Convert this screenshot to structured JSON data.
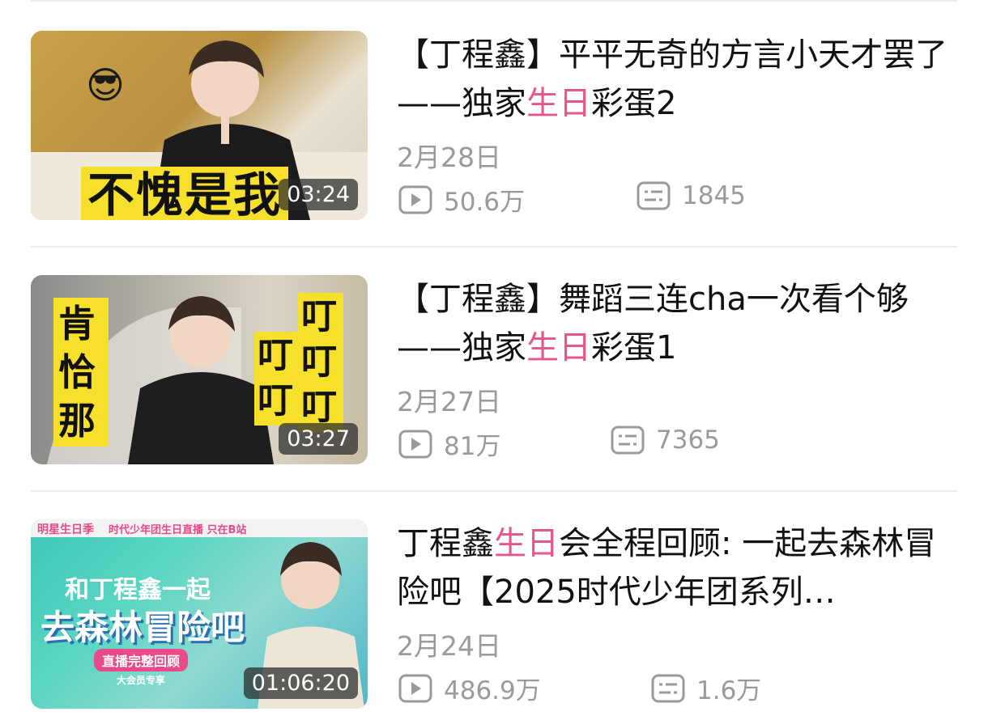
{
  "videos": [
    {
      "title_prefix": "【丁程鑫】平平无奇的方言小天才罢了——独家",
      "title_highlight": "生日",
      "title_suffix": "彩蛋2",
      "date": "2月28日",
      "views": "50.6万",
      "comments": "1845",
      "duration": "03:24",
      "cover_caption": "不愧是我",
      "cover_emoji": "😎"
    },
    {
      "title_prefix": "【丁程鑫】舞蹈三连cha一次看个够——独家",
      "title_highlight": "生日",
      "title_suffix": "彩蛋1",
      "date": "2月27日",
      "views": "81万",
      "comments": "7365",
      "duration": "03:27",
      "cover_left": "肯恰那",
      "cover_right_a": "叮叮",
      "cover_right_b": "叮叮叮"
    },
    {
      "title_prefix": "丁程鑫",
      "title_highlight": "生日",
      "title_suffix": "会全程回顾: 一起去森林冒险吧【2025时代少年团系列…",
      "date": "2月24日",
      "views": "486.9万",
      "comments": "1.6万",
      "duration": "01:06:20",
      "cover_top": "明星生日季",
      "cover_top2": "时代少年团生日直播 只在B站",
      "cover_line1": "和丁程鑫一起",
      "cover_line2": "去森林冒险吧",
      "cover_badge": "直播完整回顾",
      "cover_small": "大会员专享"
    }
  ],
  "colors": {
    "highlight": "#e5578c",
    "meta": "#9a9a9a"
  }
}
